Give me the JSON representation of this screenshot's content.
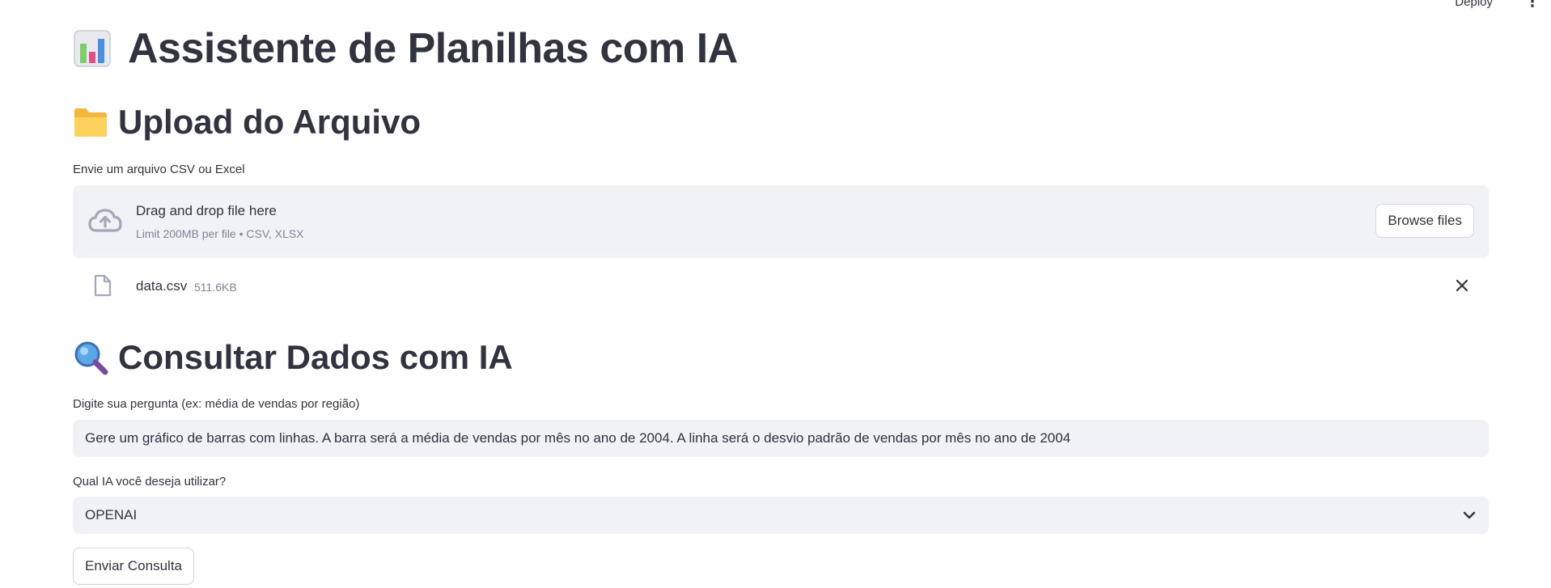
{
  "header": {
    "deploy_label": "Deploy",
    "menu_icon": "kebab-menu-icon"
  },
  "page": {
    "title": "Assistente de Planilhas com IA",
    "title_icon": "bar-chart-emoji-icon"
  },
  "upload_section": {
    "heading": "Upload do Arquivo",
    "heading_icon": "folder-emoji-icon",
    "uploader_label": "Envie um arquivo CSV ou Excel",
    "dropzone_title": "Drag and drop file here",
    "dropzone_limit": "Limit 200MB per file • CSV, XLSX",
    "browse_label": "Browse files",
    "file": {
      "name": "data.csv",
      "size": "511.6KB"
    }
  },
  "query_section": {
    "heading": "Consultar Dados com IA",
    "heading_icon": "magnifier-emoji-icon",
    "question_label": "Digite sua pergunta (ex: média de vendas por região)",
    "question_value": "Gere um gráfico de barras com linhas. A barra será a média de vendas por mês no ano de 2004. A linha será o desvio padrão de vendas por mês no ano de 2004",
    "ai_label": "Qual IA você deseja utilizar?",
    "ai_selected": "OPENAI",
    "submit_label": "Enviar Consulta"
  },
  "colors": {
    "text": "#31333f",
    "muted": "#808495",
    "input_bg": "#f0f2f6",
    "border": "#d6d6d9"
  }
}
